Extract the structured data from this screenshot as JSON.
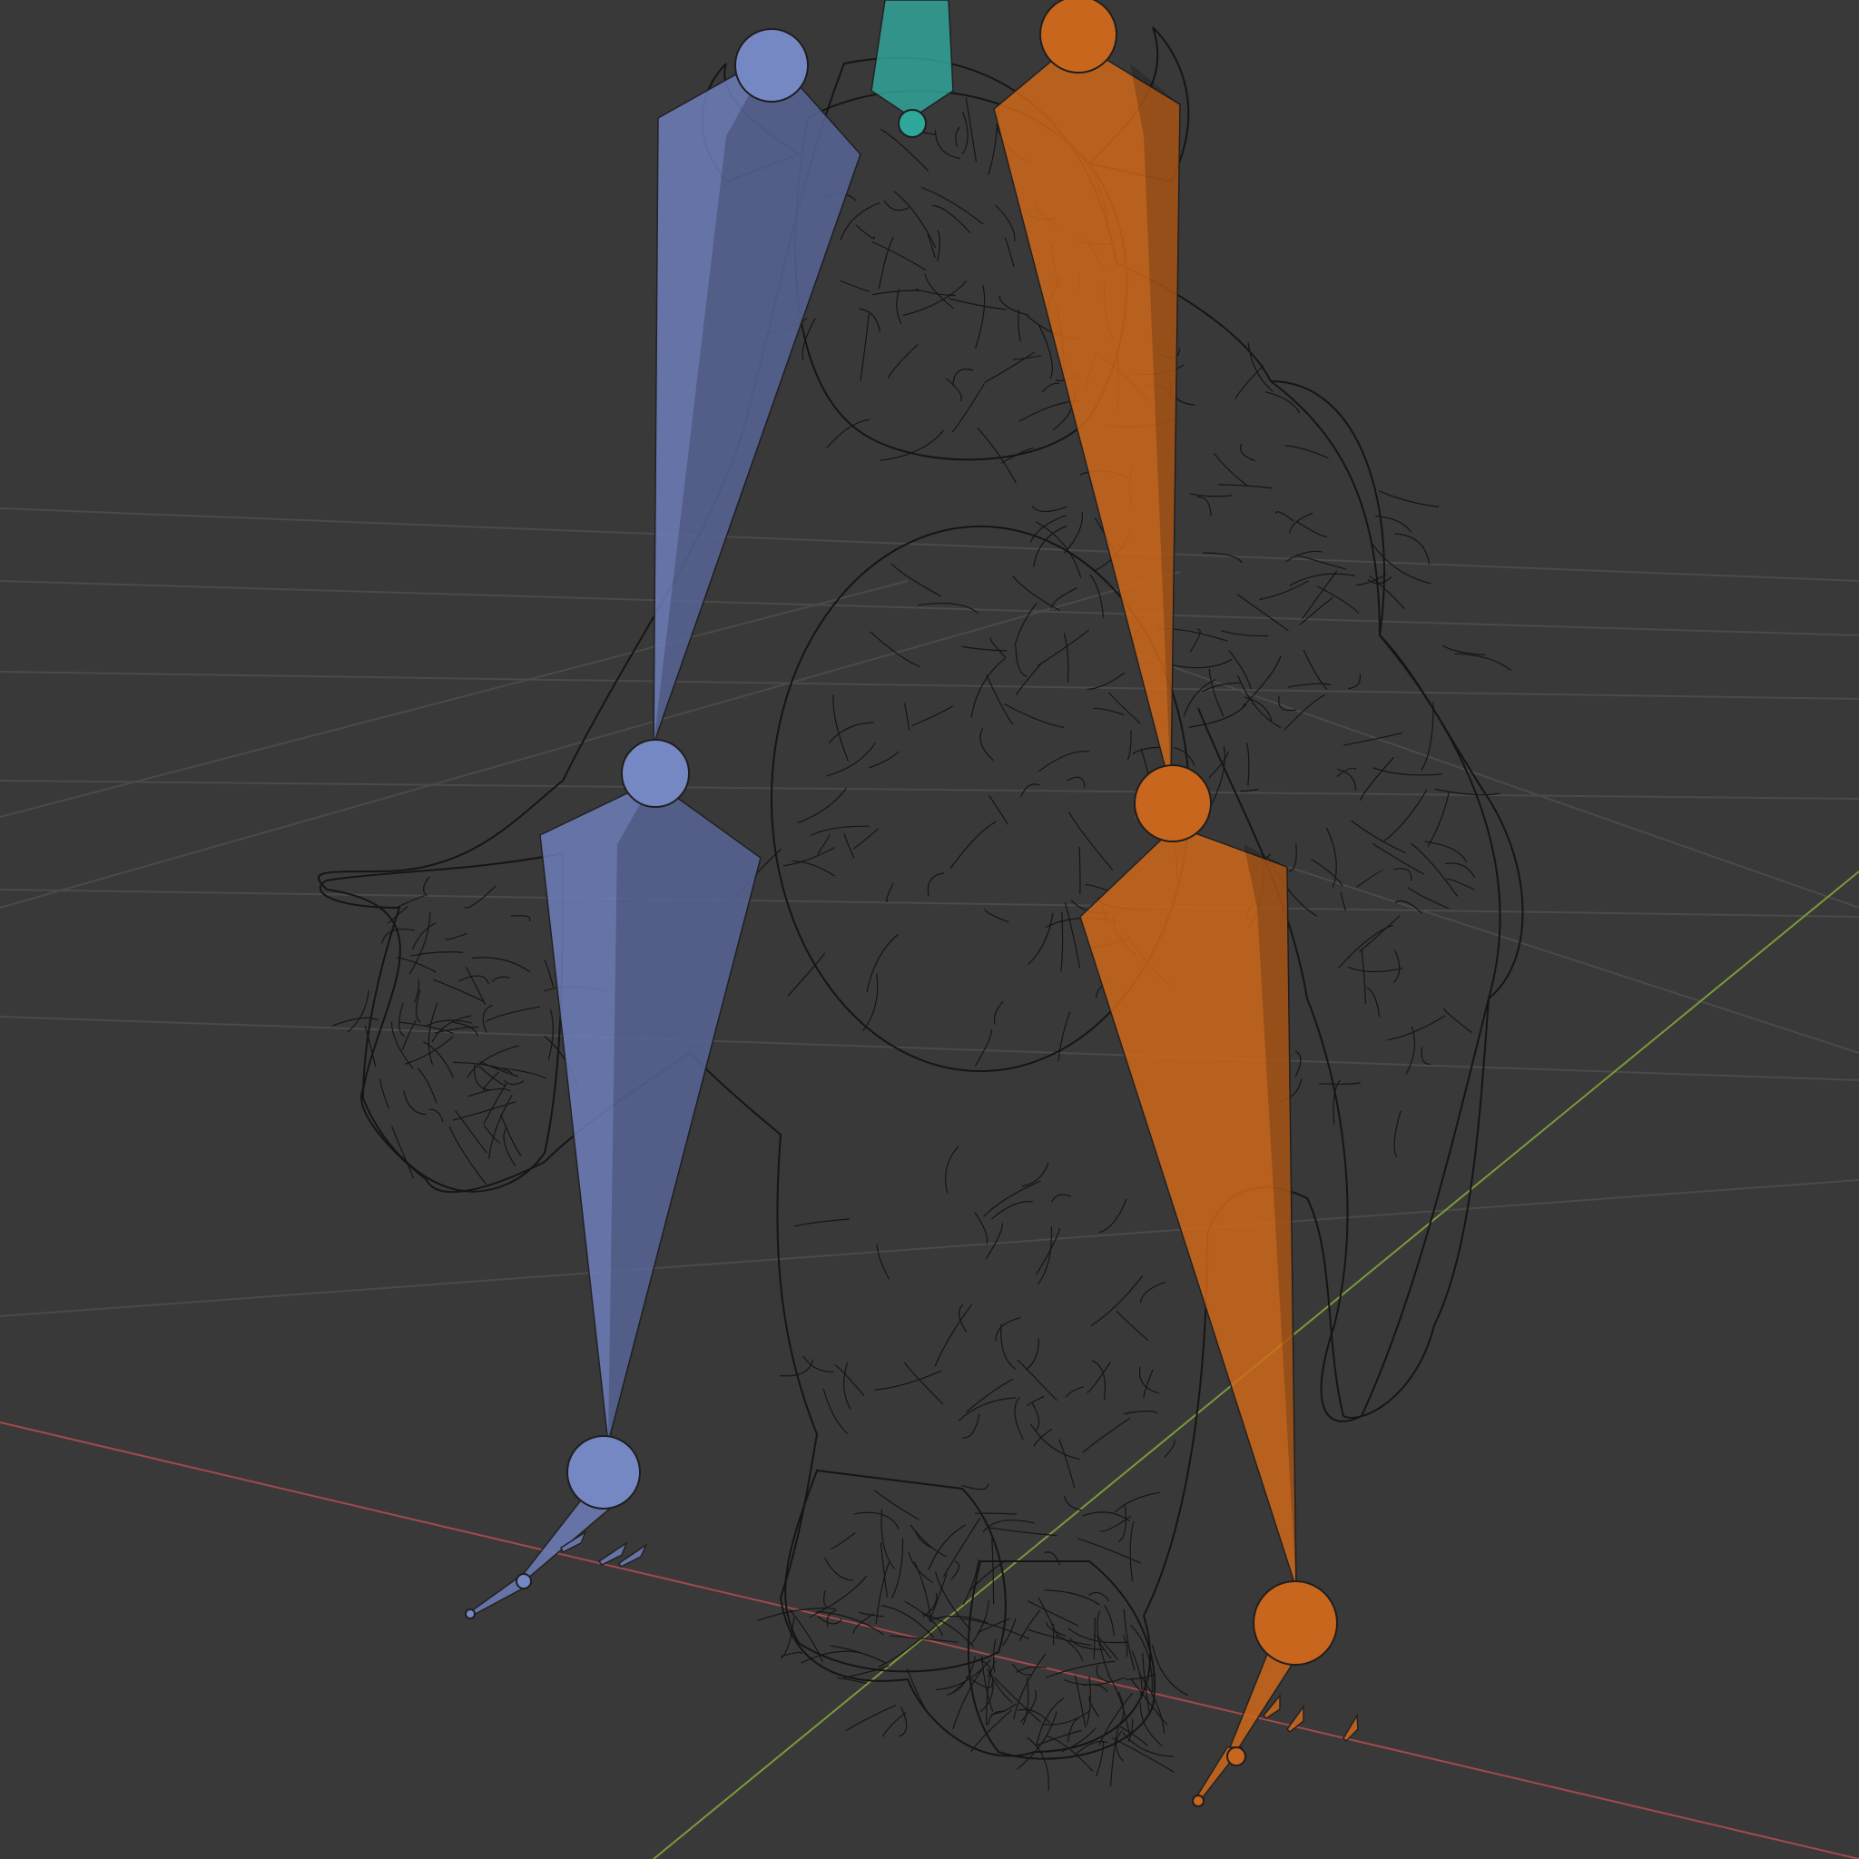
{
  "app": "3D viewport",
  "viewport": {
    "background": "#393939",
    "grid_color": "#4a4a4a",
    "x_axis_color": "#a34a4a",
    "y_axis_color": "#7a9a3a",
    "wireframe_color": "#151515",
    "shading": "wireframe",
    "overlay": "armature-bones"
  },
  "armature": {
    "bones": [
      {
        "name": "thigh-left",
        "color": "#6f80c0"
      },
      {
        "name": "shin-left",
        "color": "#6f80c0"
      },
      {
        "name": "foot-left",
        "color": "#6f80c0"
      },
      {
        "name": "thigh-right",
        "color": "#d46a1a"
      },
      {
        "name": "shin-right",
        "color": "#d46a1a"
      },
      {
        "name": "foot-right",
        "color": "#d46a1a"
      },
      {
        "name": "spine-root",
        "color": "#2fa79b"
      }
    ],
    "joints": [
      {
        "name": "hip-left-joint",
        "color": "#7688c4"
      },
      {
        "name": "knee-left-joint",
        "color": "#7688c4"
      },
      {
        "name": "ankle-left-joint",
        "color": "#7688c4"
      },
      {
        "name": "hip-right-joint",
        "color": "#c8661e"
      },
      {
        "name": "knee-right-joint",
        "color": "#c8661e"
      },
      {
        "name": "ankle-right-joint",
        "color": "#c8661e"
      },
      {
        "name": "root-joint",
        "color": "#2fa79b"
      }
    ]
  }
}
